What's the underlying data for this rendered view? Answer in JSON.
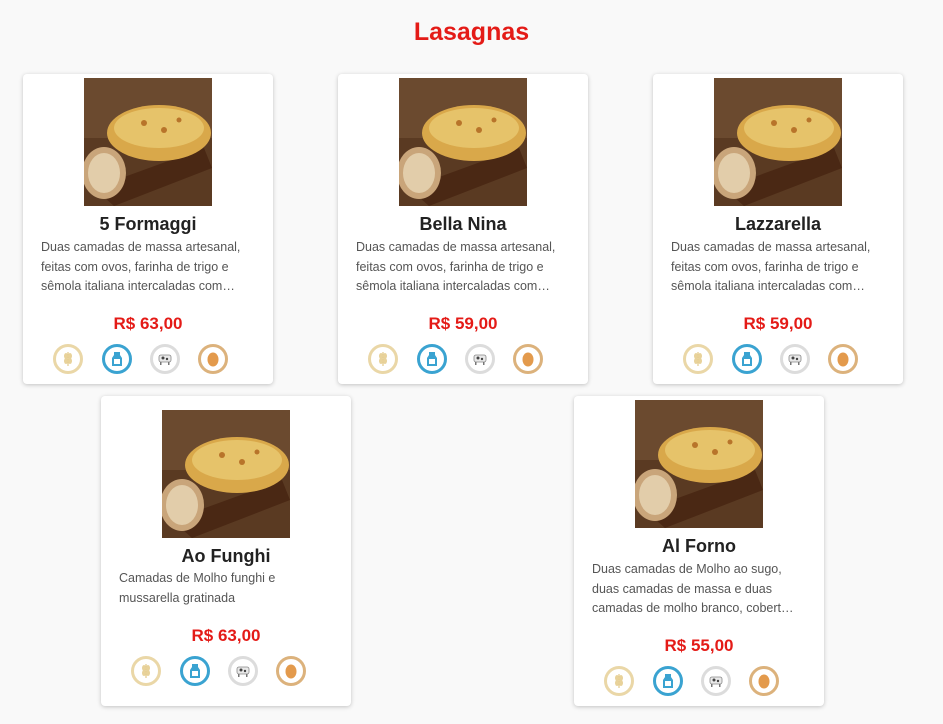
{
  "page": {
    "title": "Lasagnas"
  },
  "products": [
    {
      "name": "5 Formaggi",
      "description": "Duas camadas de massa artesanal, feitas com ovos, farinha de trigo e sêmola italiana intercaladas com…",
      "price": "R$ 63,00"
    },
    {
      "name": "Bella Nina",
      "description": "Duas camadas de massa artesanal, feitas com ovos, farinha de trigo e sêmola italiana intercaladas com…",
      "price": "R$ 59,00"
    },
    {
      "name": "Lazzarella",
      "description": "Duas camadas de massa artesanal, feitas com ovos, farinha de trigo e sêmola italiana intercaladas com…",
      "price": "R$ 59,00"
    },
    {
      "name": "Ao Funghi",
      "description": "Camadas de Molho funghi e mussarella gratinada",
      "price": "R$ 63,00"
    },
    {
      "name": "Al Forno",
      "description": "Duas camadas de Molho ao sugo, duas camadas de massa e duas camadas de molho branco, cobert…",
      "price": "R$ 55,00"
    }
  ],
  "allergen_icons": [
    "wheat-icon",
    "milk-icon",
    "cow-icon",
    "egg-icon"
  ],
  "colors": {
    "accent": "#e41b17",
    "milk": "#3aa3d1",
    "gluten": "#ead7a7",
    "egg": "#dcb27c"
  }
}
